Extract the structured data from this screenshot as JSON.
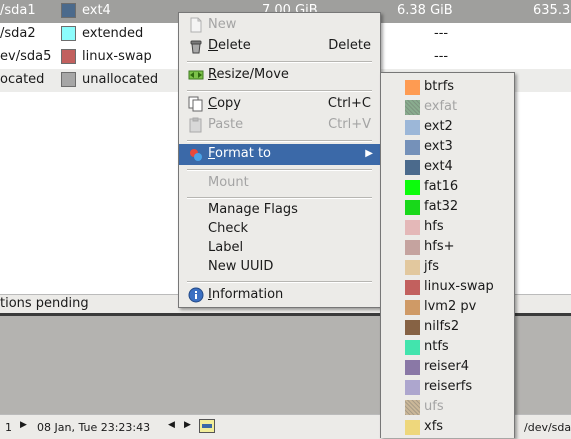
{
  "partitions": [
    {
      "path": "/sda1",
      "color": "#4b6a8c",
      "fs": "ext4",
      "size": "7.00 GiB",
      "used": "6.38 GiB",
      "unused": "635.30",
      "selected": true
    },
    {
      "path": "/sda2",
      "color": "#8cfcfc",
      "fs": "extended",
      "size": "",
      "used": "---",
      "unused": "",
      "selected": false
    },
    {
      "path": "ev/sda5",
      "color": "#c2605e",
      "fs": "linux-swap",
      "size": "",
      "used": "---",
      "unused": "",
      "selected": false
    },
    {
      "path": "ocated",
      "color": "#a6a6a6",
      "fs": "unallocated",
      "size": "",
      "used": "---",
      "unused": "",
      "selected": false
    }
  ],
  "status": {
    "pending": "tions pending",
    "page_left": "1",
    "datetime": "08 Jan, Tue 23:23:43",
    "device_right": "/dev/sda"
  },
  "menu": {
    "new": "New",
    "delete": "Delete",
    "delete_accel": "Delete",
    "resize_move": "Resize/Move",
    "copy": "Copy",
    "copy_accel": "Ctrl+C",
    "paste": "Paste",
    "paste_accel": "Ctrl+V",
    "format_to": "Format to",
    "mount": "Mount",
    "manage_flags": "Manage Flags",
    "check": "Check",
    "label": "Label",
    "new_uuid": "New UUID",
    "information": "Information"
  },
  "format_options": [
    {
      "name": "btrfs",
      "color": "#fe9b52",
      "disabled": false
    },
    {
      "name": "exfat",
      "color": "#3a7a45",
      "disabled": true
    },
    {
      "name": "ext2",
      "color": "#9cb7d8",
      "disabled": false
    },
    {
      "name": "ext3",
      "color": "#7591b9",
      "disabled": false
    },
    {
      "name": "ext4",
      "color": "#4b6a8c",
      "disabled": false
    },
    {
      "name": "fat16",
      "color": "#0cfc0c",
      "disabled": false
    },
    {
      "name": "fat32",
      "color": "#18d81a",
      "disabled": false
    },
    {
      "name": "hfs",
      "color": "#e4b8b8",
      "disabled": false
    },
    {
      "name": "hfs+",
      "color": "#c5a39f",
      "disabled": false
    },
    {
      "name": "jfs",
      "color": "#e2c89e",
      "disabled": false
    },
    {
      "name": "linux-swap",
      "color": "#c2605e",
      "disabled": false
    },
    {
      "name": "lvm2 pv",
      "color": "#cf9a66",
      "disabled": false
    },
    {
      "name": "nilfs2",
      "color": "#866244",
      "disabled": false
    },
    {
      "name": "ntfs",
      "color": "#42e4ad",
      "disabled": false
    },
    {
      "name": "reiser4",
      "color": "#8a78a6",
      "disabled": false
    },
    {
      "name": "reiserfs",
      "color": "#ada6ce",
      "disabled": false
    },
    {
      "name": "ufs",
      "color": "#b08e58",
      "disabled": true
    },
    {
      "name": "xfs",
      "color": "#eed77c",
      "disabled": false
    }
  ],
  "colors": {
    "selection": "#3b69a8",
    "menu_bg": "#ecebe8"
  }
}
